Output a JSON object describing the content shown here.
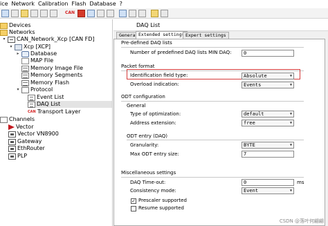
{
  "menu": [
    "ice",
    "Network",
    "Calibration",
    "Flash",
    "Database",
    "?"
  ],
  "toolbar": {
    "can_badge": "CAN"
  },
  "tree": {
    "devices": "Devices",
    "networks": "Networks",
    "network_node": "CAN_Network_Xcp [CAN FD]",
    "ecu": "Xcp [XCP]",
    "database": "Database",
    "map_file": "MAP File",
    "memory_image_file": "Memory Image File",
    "memory_segments": "Memory Segments",
    "memory_flash": "Memory Flash",
    "protocol": "Protocol",
    "event_list": "Event List",
    "daq_list": "DAQ List",
    "transport_layer": "Transport Layer",
    "transport_badge": "CAN",
    "channels": "Channels",
    "vector": "Vector",
    "vector_vn8900": "Vector VN8900",
    "gateway": "Gateway",
    "ethrouter": "EthRouter",
    "plp": "PLP"
  },
  "pane": {
    "title": "DAQ List",
    "tabs": [
      "General",
      "Extended settings",
      "Expert settings"
    ]
  },
  "form": {
    "predefined_section": "Pre-defined DAQ lists",
    "num_predefined_label": "Number of predefined DAQ lists MIN DAQ:",
    "num_predefined_value": "0",
    "packet_format_section": "Packet format",
    "identification_label": "Identification field type:",
    "identification_value": "Absolute",
    "overload_label": "Overload indication:",
    "overload_value": "Events",
    "odt_config_section": "ODT configuration",
    "general_subsection": "General",
    "optimization_label": "Type of optimization:",
    "optimization_value": "default",
    "address_ext_label": "Address extension:",
    "address_ext_value": "free",
    "odt_entry_section": "ODT entry (DAQ)",
    "granularity_label": "Granularity:",
    "granularity_value": "BYTE",
    "max_odt_label": "Max ODT entry size:",
    "max_odt_value": "7",
    "misc_section": "Miscellaneous settings",
    "daq_timeout_label": "DAQ Time-out:",
    "daq_timeout_value": "0",
    "daq_timeout_unit": "ms",
    "consistency_label": "Consistency mode:",
    "consistency_value": "Event",
    "prescaler_label": "Prescaler supported",
    "prescaler_checked": true,
    "resume_label": "Resume supported",
    "resume_checked": false
  },
  "watermark": "CSDN @落叶何翩翩",
  "colors": {
    "highlight_border": "#d63b3b",
    "selected_row": "#e3e3e3",
    "can_red": "#d41f1f"
  }
}
